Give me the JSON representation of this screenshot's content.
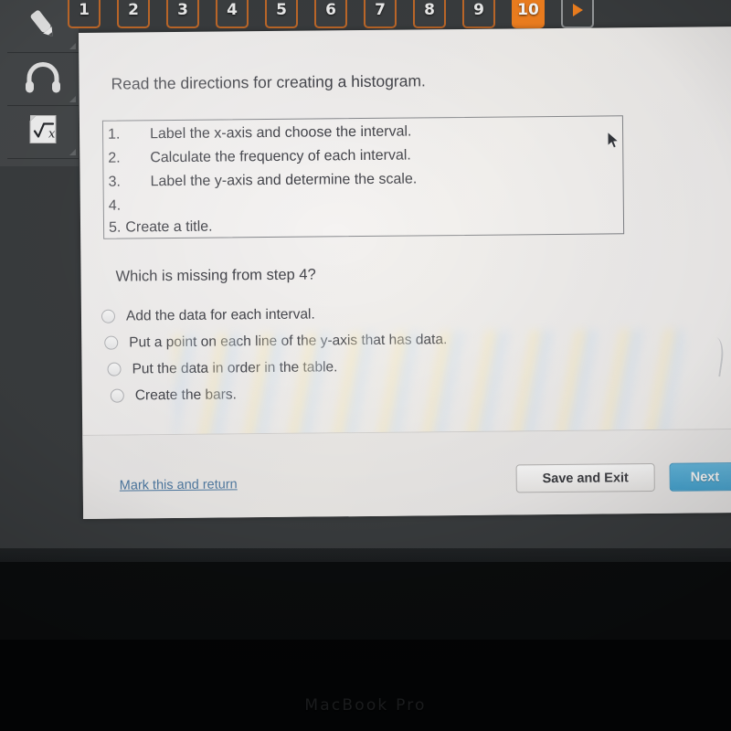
{
  "device": {
    "brand_label": "MacBook Pro"
  },
  "toolbar": {
    "tools": [
      {
        "name": "highlighter-tool",
        "icon": "pencil-icon"
      },
      {
        "name": "audio-tool",
        "icon": "headphones-icon"
      },
      {
        "name": "calculator-tool",
        "icon": "sqrt-calculator-icon"
      }
    ]
  },
  "question_nav": {
    "items": [
      {
        "label": "1",
        "active": false
      },
      {
        "label": "2",
        "active": false
      },
      {
        "label": "3",
        "active": false
      },
      {
        "label": "4",
        "active": false
      },
      {
        "label": "5",
        "active": false
      },
      {
        "label": "6",
        "active": false
      },
      {
        "label": "7",
        "active": false
      },
      {
        "label": "8",
        "active": false
      },
      {
        "label": "9",
        "active": false
      },
      {
        "label": "10",
        "active": true
      }
    ],
    "next_arrow": {
      "name": "next-arrow-button",
      "icon": "play-triangle-icon"
    },
    "active_color": "#f58220",
    "outline_color": "#c26a2a"
  },
  "content": {
    "prompt": "Read the directions for creating a histogram.",
    "steps": [
      {
        "number": "1.",
        "text": "Label the x-axis and choose the interval."
      },
      {
        "number": "2.",
        "text": "Calculate the frequency of each interval."
      },
      {
        "number": "3.",
        "text": "Label the y-axis and determine the scale."
      },
      {
        "number": "4.",
        "text": ""
      },
      {
        "number": "5.",
        "text": "Create a title."
      }
    ],
    "question": "Which is missing from step 4?",
    "options": [
      {
        "label": "Add the data for each interval.",
        "selected": false
      },
      {
        "label": "Put a point on each line of the y-axis that has data.",
        "selected": false
      },
      {
        "label": "Put the data in order in the table.",
        "selected": false
      },
      {
        "label": "Create the bars.",
        "selected": false
      }
    ]
  },
  "footer": {
    "mark_link": "Mark this and return",
    "save_button": "Save and Exit",
    "next_button": "Next",
    "next_button_color": "#2f9bce",
    "link_color": "#3f6f9c"
  }
}
